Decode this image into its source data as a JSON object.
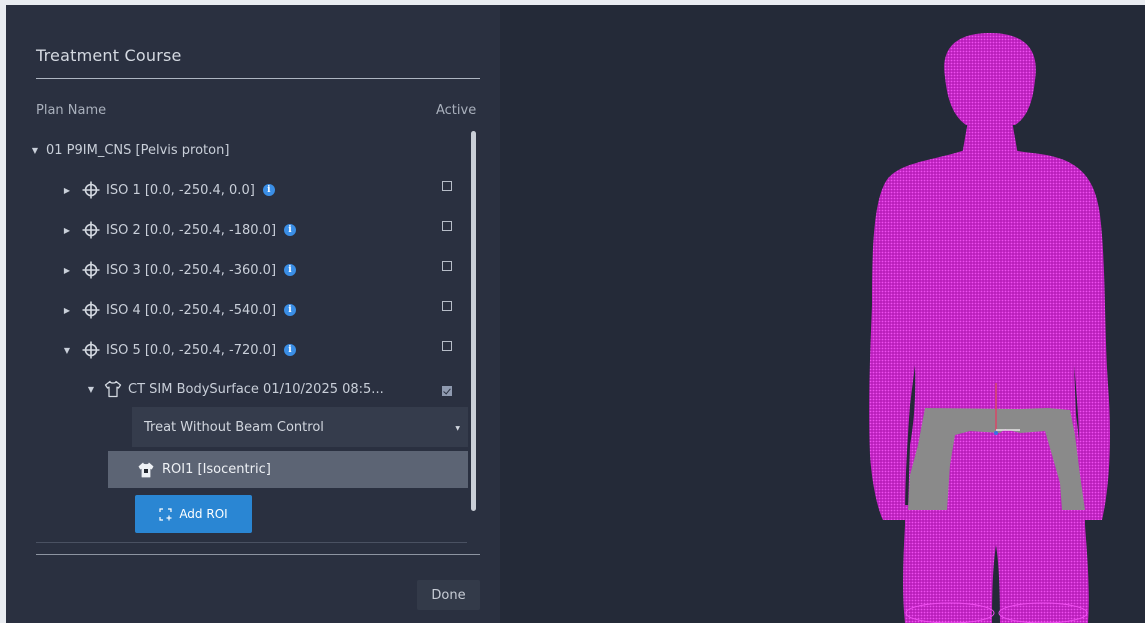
{
  "panel": {
    "title": "Treatment Course",
    "columns": {
      "plan_name": "Plan Name",
      "active": "Active"
    }
  },
  "tree": {
    "plan": {
      "label": "01 P9IM_CNS [Pelvis proton]",
      "expanded": true
    },
    "isocenters": [
      {
        "label": "ISO 1 [0.0, -250.4, 0.0]",
        "expanded": false,
        "active": false
      },
      {
        "label": "ISO 2 [0.0, -250.4, -180.0]",
        "expanded": false,
        "active": false
      },
      {
        "label": "ISO 3 [0.0, -250.4, -360.0]",
        "expanded": false,
        "active": false
      },
      {
        "label": "ISO 4 [0.0, -250.4, -540.0]",
        "expanded": false,
        "active": false
      },
      {
        "label": "ISO 5 [0.0, -250.4, -720.0]",
        "expanded": true,
        "active": false
      }
    ],
    "surface": {
      "label": "CT SIM BodySurface 01/10/2025 08:5...",
      "expanded": true,
      "active": true
    },
    "beam_control": {
      "selected": "Treat Without Beam Control"
    },
    "roi": {
      "label": "ROI1 [Isocentric]"
    },
    "add_roi_label": "Add ROI"
  },
  "footer": {
    "done_label": "Done"
  },
  "colors": {
    "accent": "#2a86d3",
    "info": "#3a8ee6",
    "surface_mesh": "#d62fd6",
    "roi_region": "#8a8a8a"
  },
  "icons": {
    "isocenter": "crosshair-icon",
    "info": "info-icon",
    "body_surface": "body-outline-icon",
    "roi": "roi-body-icon",
    "add_roi": "add-roi-icon"
  }
}
